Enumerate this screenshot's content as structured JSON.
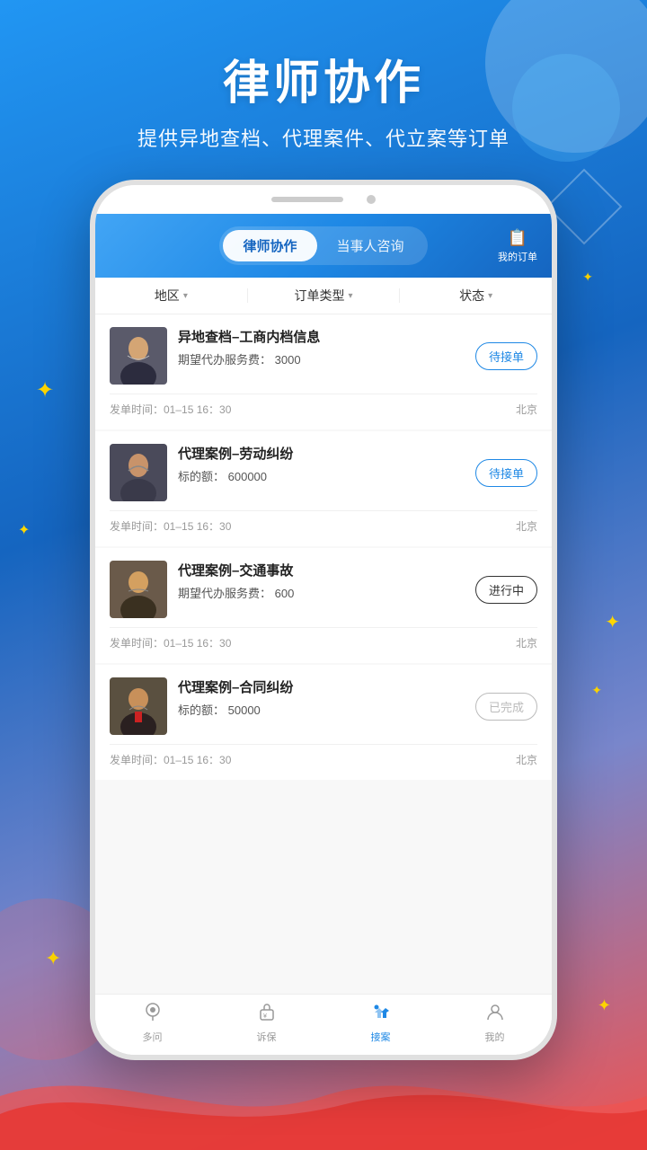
{
  "app": {
    "background_gradient": [
      "#2196F3",
      "#1565C0",
      "#ef5350"
    ],
    "header": {
      "title": "律师协作",
      "subtitle": "提供异地查档、代理案件、代立案等订单"
    },
    "tabs": [
      {
        "id": "lawyer",
        "label": "律师协作",
        "active": true
      },
      {
        "id": "client",
        "label": "当事人咨询",
        "active": false
      }
    ],
    "my_orders": {
      "icon": "📋",
      "label": "我的订单"
    },
    "filters": [
      {
        "id": "region",
        "label": "地区"
      },
      {
        "id": "order_type",
        "label": "订单类型"
      },
      {
        "id": "status",
        "label": "状态"
      }
    ],
    "orders": [
      {
        "id": 1,
        "title": "异地查档–工商内档信息",
        "detail_label": "期望代办服务费：",
        "detail_value": "3000",
        "time": "发单时间：01–15 16：30",
        "location": "北京",
        "status": "待接单",
        "status_type": "pending"
      },
      {
        "id": 2,
        "title": "代理案例–劳动纠纷",
        "detail_label": "标的额：",
        "detail_value": "600000",
        "time": "发单时间：01–15 16：30",
        "location": "北京",
        "status": "待接单",
        "status_type": "pending"
      },
      {
        "id": 3,
        "title": "代理案例–交通事故",
        "detail_label": "期望代办服务费：",
        "detail_value": "600",
        "time": "发单时间：01–15 16：30",
        "location": "北京",
        "status": "进行中",
        "status_type": "progress"
      },
      {
        "id": 4,
        "title": "代理案例–合同纠纷",
        "detail_label": "标的额：",
        "detail_value": "50000",
        "time": "发单时间：01–15 16：30",
        "location": "北京",
        "status": "已完成",
        "status_type": "done"
      }
    ],
    "bottom_nav": [
      {
        "id": "ask",
        "label": "多问",
        "icon": "💬",
        "active": false
      },
      {
        "id": "claim",
        "label": "诉保",
        "icon": "🔒",
        "active": false
      },
      {
        "id": "accept",
        "label": "接案",
        "icon": "🤝",
        "active": true
      },
      {
        "id": "mine",
        "label": "我的",
        "icon": "👤",
        "active": false
      }
    ]
  }
}
